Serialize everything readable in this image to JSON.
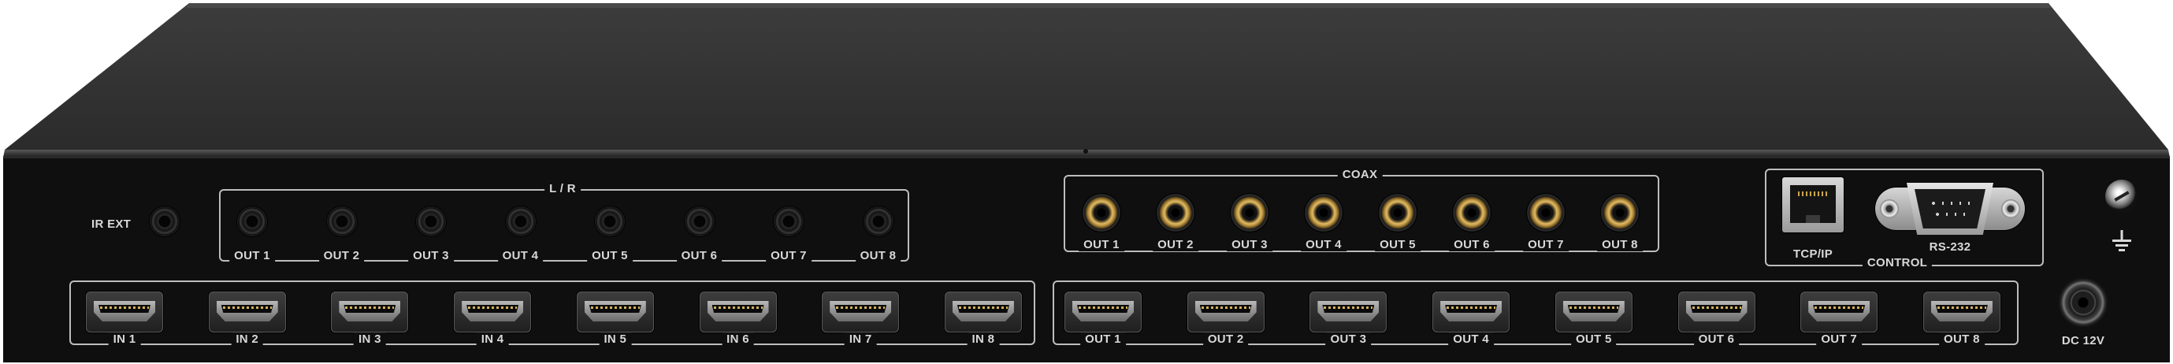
{
  "rear_panel": {
    "ir_ext_label": "IR EXT",
    "lr_group": {
      "title": "L / R",
      "outputs": [
        "OUT 1",
        "OUT 2",
        "OUT 3",
        "OUT 4",
        "OUT 5",
        "OUT 6",
        "OUT 7",
        "OUT 8"
      ]
    },
    "coax_group": {
      "title": "COAX",
      "outputs": [
        "OUT 1",
        "OUT 2",
        "OUT 3",
        "OUT 4",
        "OUT 5",
        "OUT 6",
        "OUT 7",
        "OUT 8"
      ]
    },
    "hdmi_inputs": [
      "IN 1",
      "IN 2",
      "IN 3",
      "IN 4",
      "IN 5",
      "IN 6",
      "IN 7",
      "IN 8"
    ],
    "hdmi_outputs": [
      "OUT 1",
      "OUT 2",
      "OUT 3",
      "OUT 4",
      "OUT 5",
      "OUT 6",
      "OUT 7",
      "OUT 8"
    ],
    "control": {
      "title": "CONTROL",
      "tcpip_label": "TCP/IP",
      "rs232_label": "RS-232"
    },
    "power_label": "DC 12V",
    "colors": {
      "panel": "#0f0f0f",
      "top_cover": "#363636",
      "label_text": "#d9d9d9",
      "gold_contact": "#e0bd6a"
    },
    "icons": [
      "ethernet-port-icon",
      "serial-port-icon",
      "ground-screw-icon",
      "ground-symbol-icon",
      "dc-power-jack-icon"
    ]
  }
}
